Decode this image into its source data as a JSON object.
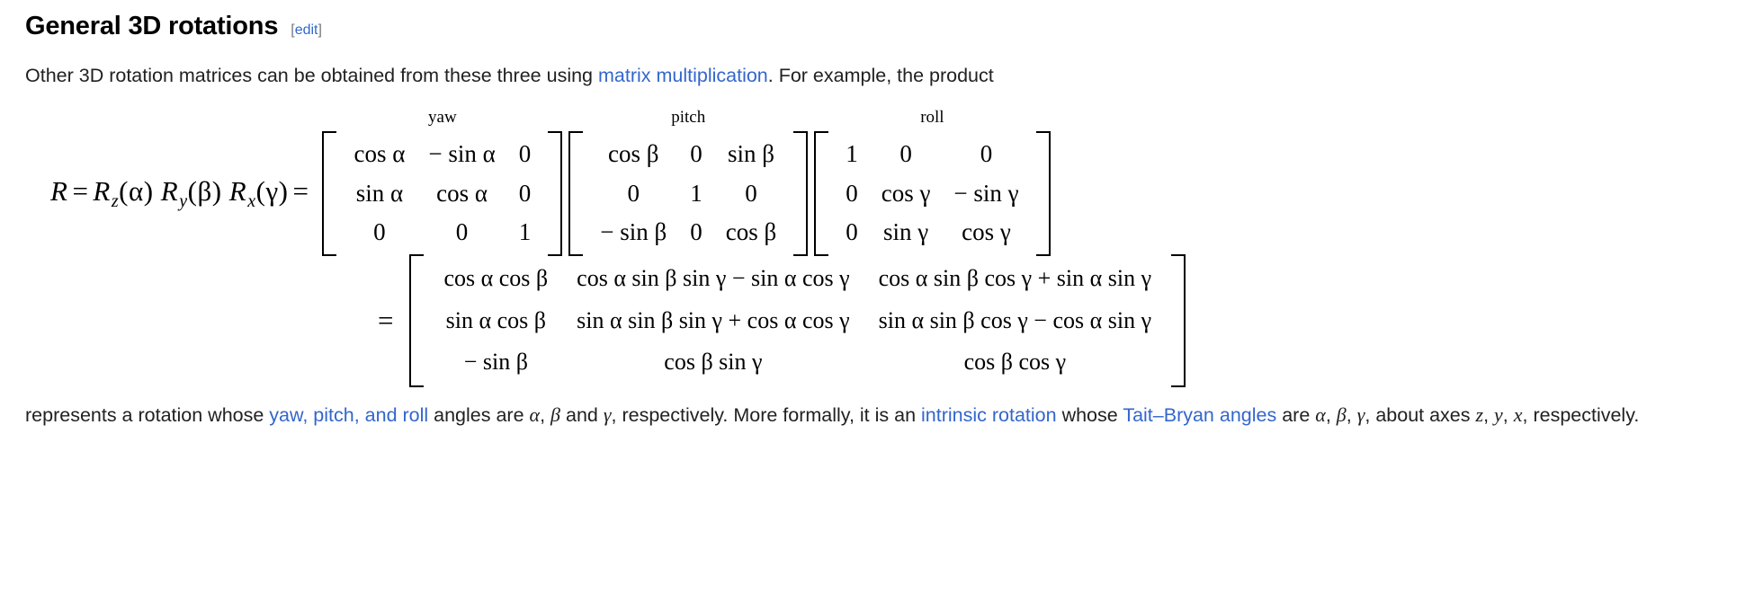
{
  "section": {
    "title": "General 3D rotations",
    "edit": {
      "open_bracket": "[",
      "label": "edit",
      "close_bracket": "]"
    }
  },
  "intro": {
    "text_before": "Other 3D rotation matrices can be obtained from these three using ",
    "link": "matrix multiplication",
    "text_after": ". For example, the product"
  },
  "equation": {
    "lhs": {
      "R": "R",
      "equals": "=",
      "Rz": "R",
      "z": "z",
      "alpha_paren": "(α)",
      "Ry": "R",
      "y": "y",
      "beta_paren": "(β)",
      "Rx": "R",
      "x": "x",
      "gamma_paren": "(γ)",
      "equals2": "="
    },
    "second_line_equals": "=",
    "matrices": [
      {
        "label": "yaw",
        "rows": [
          [
            "cos α",
            "− sin α",
            "0"
          ],
          [
            "sin α",
            "cos α",
            "0"
          ],
          [
            "0",
            "0",
            "1"
          ]
        ]
      },
      {
        "label": "pitch",
        "rows": [
          [
            "cos β",
            "0",
            "sin β"
          ],
          [
            "0",
            "1",
            "0"
          ],
          [
            "− sin β",
            "0",
            "cos β"
          ]
        ]
      },
      {
        "label": "roll",
        "rows": [
          [
            "1",
            "0",
            "0"
          ],
          [
            "0",
            "cos γ",
            "− sin γ"
          ],
          [
            "0",
            "sin γ",
            "cos γ"
          ]
        ]
      }
    ],
    "product": {
      "rows": [
        [
          "cos α cos β",
          "cos α sin β sin γ − sin α cos γ",
          "cos α sin β cos γ + sin α sin γ"
        ],
        [
          "sin α cos β",
          "sin α sin β sin γ + cos α cos γ",
          "sin α sin β cos γ − cos α sin γ"
        ],
        [
          "− sin β",
          "cos β sin γ",
          "cos β cos γ"
        ]
      ]
    }
  },
  "outro": {
    "t1": "represents a rotation whose ",
    "link1": "yaw, pitch, and roll",
    "t2": " angles are ",
    "v_alpha": "α",
    "t3": ", ",
    "v_beta": "β",
    "t4": " and ",
    "v_gamma": "γ",
    "t5": ", respectively. More formally, it is an ",
    "link2": "intrinsic rotation",
    "t6": " whose ",
    "link3": "Tait–Bryan angles",
    "t7": " are ",
    "v_alpha2": "α",
    "t8": ", ",
    "v_beta2": "β",
    "t9": ", ",
    "v_gamma2": "γ",
    "t10": ", about axes ",
    "ax_z": "z",
    "t11": ", ",
    "ax_y": "y",
    "t12": ", ",
    "ax_x": "x",
    "t13": ", respectively."
  },
  "colors": {
    "link": "#3366cc",
    "text": "#202122",
    "background": "#ffffff"
  }
}
